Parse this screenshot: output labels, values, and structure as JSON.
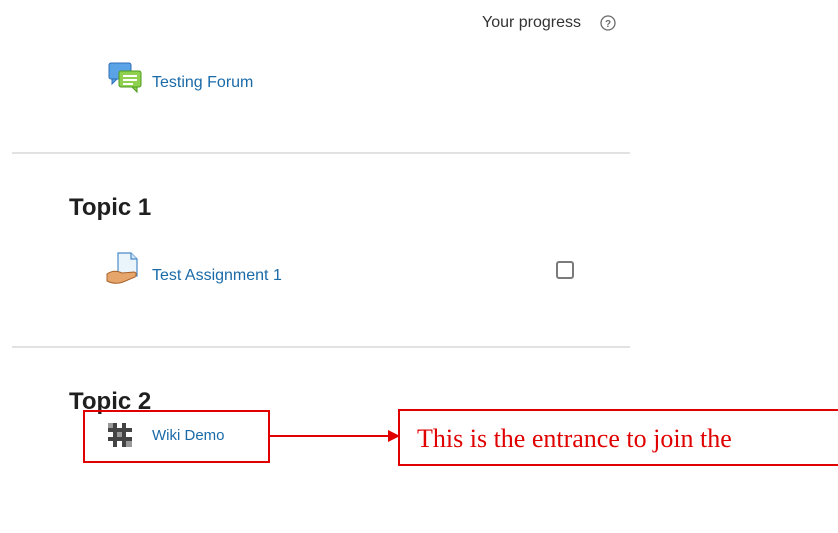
{
  "progress": {
    "label": "Your progress",
    "help_icon": "question-circle-icon"
  },
  "general_section": {
    "activities": [
      {
        "label": "Testing Forum",
        "icon": "forum-icon"
      }
    ]
  },
  "topic1": {
    "title": "Topic 1",
    "activities": [
      {
        "label": "Test Assignment 1",
        "icon": "assignment-icon",
        "completed": false
      }
    ]
  },
  "topic2": {
    "title": "Topic 2",
    "activities": [
      {
        "label": "Wiki Demo",
        "icon": "wiki-icon"
      }
    ]
  },
  "annotation": {
    "text": "This is the entrance to join the",
    "color": "#e00000"
  },
  "colors": {
    "link": "#1a6aa8",
    "annotation": "#e00000"
  }
}
